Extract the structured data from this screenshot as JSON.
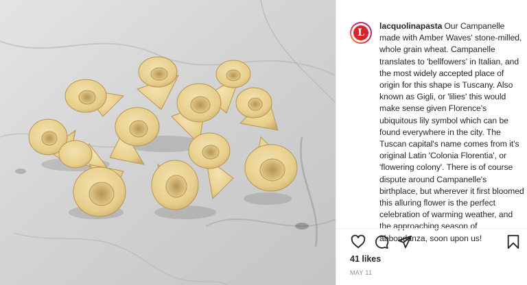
{
  "photo": {
    "subject": "campanelle-pasta-on-marble"
  },
  "post": {
    "username": "lacquolinapasta",
    "avatar_letter": "L",
    "caption": "Our Campanelle made with Amber Waves' stone-milled, whole grain wheat. Campanelle translates to 'bellfowers' in Italian, and the most widely accepted place of origin for this shape is Tuscany. Also known as Gigli, or 'lilies' this would make sense given Florence's ubiquitous lily symbol which can be found everywhere in the city. The Tuscan capital's name comes from it's original Latin 'Colonia Florentia', or 'flowering colony'. There is of course dispute around Campanelle's birthplace, but wherever it first bloomed this alluring flower is the perfect celebration of warming weather, and the approaching season of abbondanza, soon upon us!",
    "likes": "41 likes",
    "date": "MAY 11"
  },
  "actions": {
    "like_icon": "heart-icon",
    "comment_icon": "comment-icon",
    "share_icon": "share-icon",
    "save_icon": "bookmark-icon"
  },
  "colors": {
    "avatar_red": "#d6262b",
    "text": "#262626",
    "muted": "#8e8e8e"
  }
}
